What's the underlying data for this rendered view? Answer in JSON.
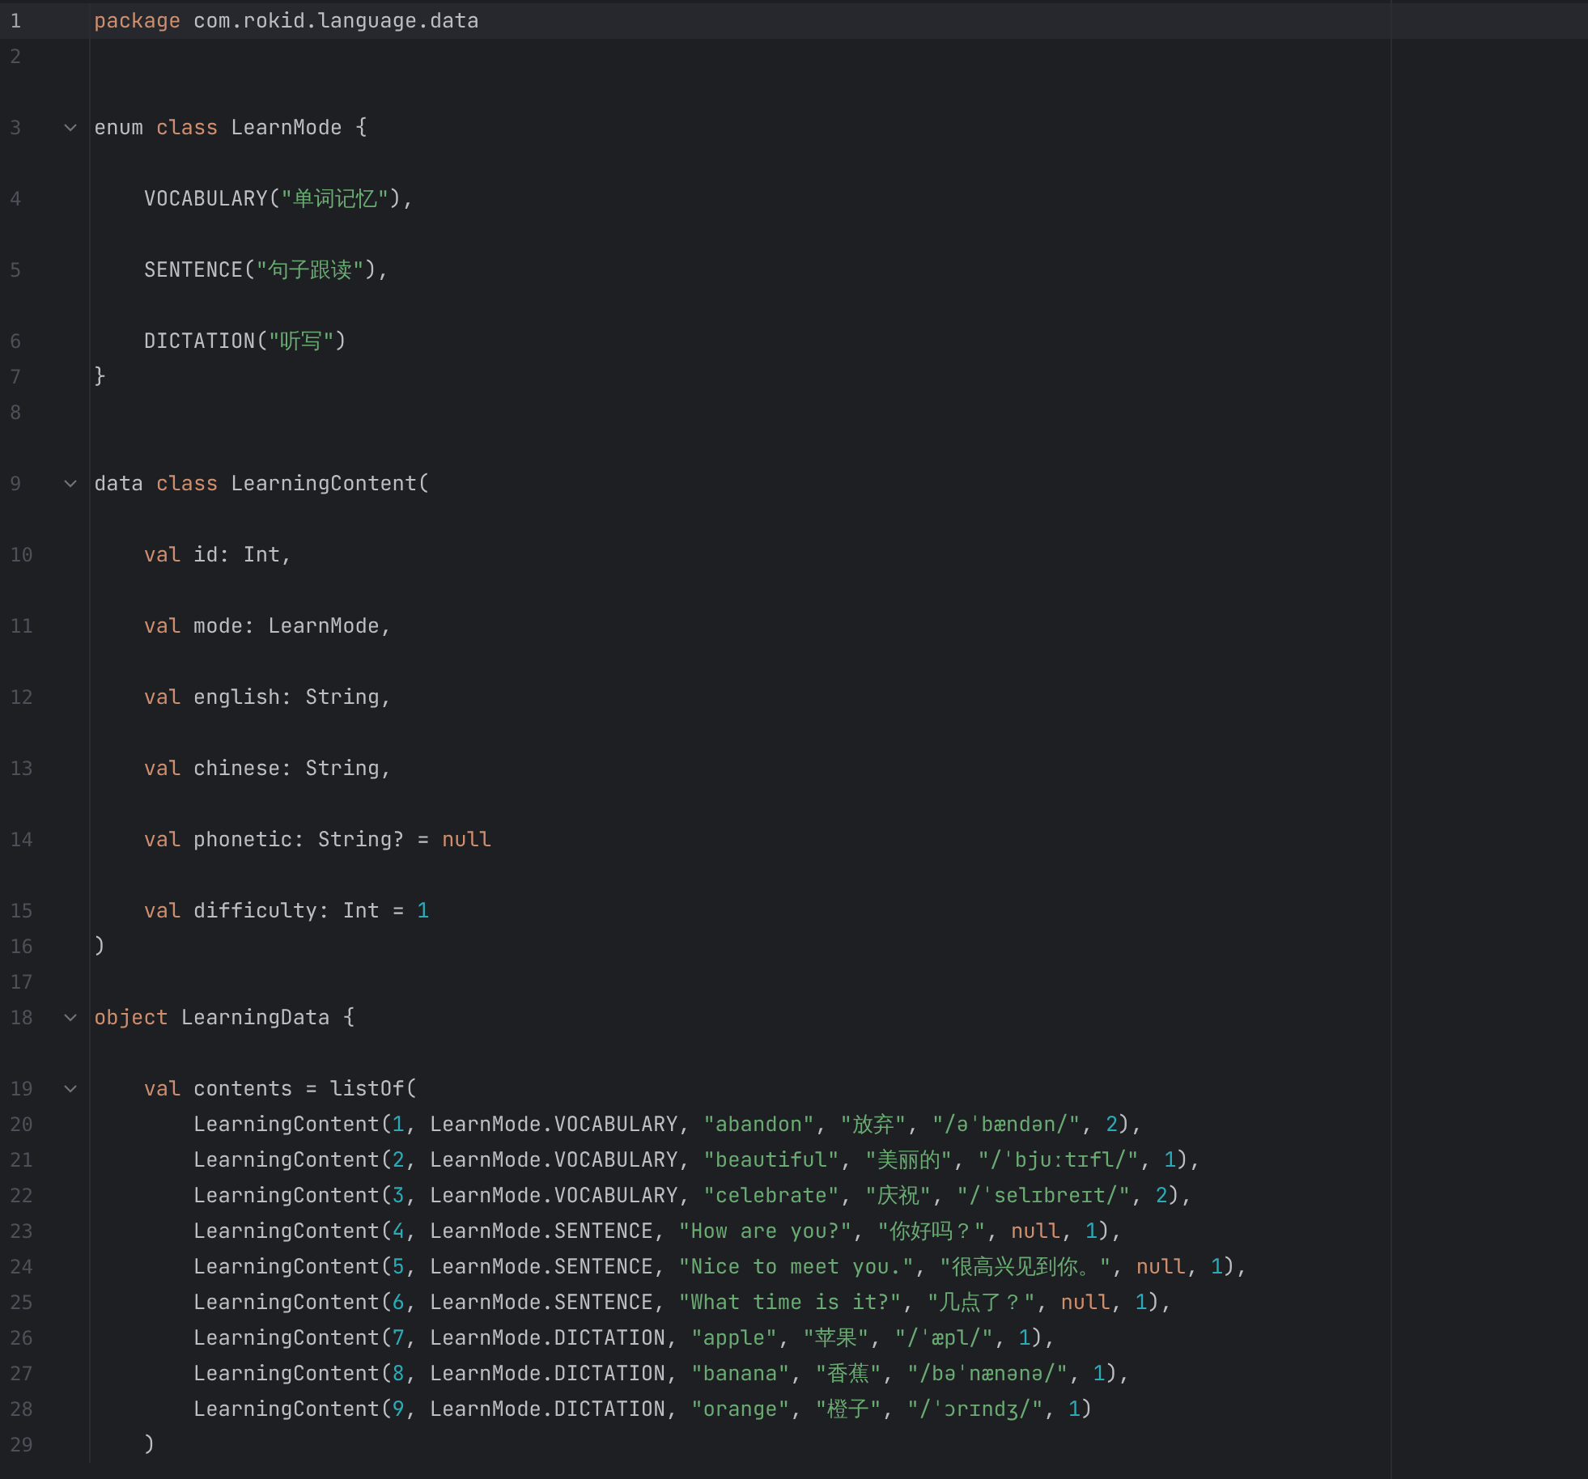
{
  "editor": {
    "lines": [
      {
        "number": "1",
        "current": true,
        "tokens": [
          {
            "kind": "kw",
            "text": "package"
          },
          {
            "kind": "plain",
            "text": " com.rokid.language.data"
          }
        ]
      },
      {
        "number": "2",
        "current": false
      },
      {
        "number": "3",
        "current": false,
        "hint_gap": true,
        "foldable": true,
        "tokens": [
          {
            "kind": "plain",
            "text": "enum "
          },
          {
            "kind": "kw",
            "text": "class"
          },
          {
            "kind": "plain",
            "text": " LearnMode {"
          }
        ]
      },
      {
        "number": "4",
        "current": false,
        "hint_gap": true,
        "tokens": [
          {
            "kind": "plain",
            "text": "    VOCABULARY("
          },
          {
            "kind": "str",
            "text": "\"单词记忆\""
          },
          {
            "kind": "plain",
            "text": "),"
          }
        ]
      },
      {
        "number": "5",
        "current": false,
        "hint_gap": true,
        "tokens": [
          {
            "kind": "plain",
            "text": "    SENTENCE("
          },
          {
            "kind": "str",
            "text": "\"句子跟读\""
          },
          {
            "kind": "plain",
            "text": "),"
          }
        ]
      },
      {
        "number": "6",
        "current": false,
        "hint_gap": true,
        "tokens": [
          {
            "kind": "plain",
            "text": "    DICTATION("
          },
          {
            "kind": "str",
            "text": "\"听写\""
          },
          {
            "kind": "plain",
            "text": ")"
          }
        ]
      },
      {
        "number": "7",
        "current": false,
        "tokens": [
          {
            "kind": "plain",
            "text": "}"
          }
        ]
      },
      {
        "number": "8",
        "current": false
      },
      {
        "number": "9",
        "current": false,
        "hint_gap": true,
        "foldable": true,
        "tokens": [
          {
            "kind": "plain",
            "text": "data "
          },
          {
            "kind": "kw",
            "text": "class"
          },
          {
            "kind": "plain",
            "text": " LearningContent("
          }
        ]
      },
      {
        "number": "10",
        "current": false,
        "hint_gap": true,
        "tokens": [
          {
            "kind": "kw",
            "text": "    val"
          },
          {
            "kind": "plain",
            "text": " id: Int,"
          }
        ]
      },
      {
        "number": "11",
        "current": false,
        "hint_gap": true,
        "tokens": [
          {
            "kind": "kw",
            "text": "    val"
          },
          {
            "kind": "plain",
            "text": " mode: LearnMode,"
          }
        ]
      },
      {
        "number": "12",
        "current": false,
        "hint_gap": true,
        "tokens": [
          {
            "kind": "kw",
            "text": "    val"
          },
          {
            "kind": "plain",
            "text": " english: String,"
          }
        ]
      },
      {
        "number": "13",
        "current": false,
        "hint_gap": true,
        "tokens": [
          {
            "kind": "kw",
            "text": "    val"
          },
          {
            "kind": "plain",
            "text": " chinese: String,"
          }
        ]
      },
      {
        "number": "14",
        "current": false,
        "hint_gap": true,
        "tokens": [
          {
            "kind": "kw",
            "text": "    val"
          },
          {
            "kind": "plain",
            "text": " phonetic: String? = "
          },
          {
            "kind": "kw",
            "text": "null"
          }
        ]
      },
      {
        "number": "15",
        "current": false,
        "hint_gap": true,
        "tokens": [
          {
            "kind": "kw",
            "text": "    val"
          },
          {
            "kind": "plain",
            "text": " difficulty: Int = "
          },
          {
            "kind": "num",
            "text": "1"
          }
        ]
      },
      {
        "number": "16",
        "current": false,
        "tokens": [
          {
            "kind": "plain",
            "text": ")"
          }
        ]
      },
      {
        "number": "17",
        "current": false
      },
      {
        "number": "18",
        "current": false,
        "foldable": true,
        "tokens": [
          {
            "kind": "kw",
            "text": "object"
          },
          {
            "kind": "plain",
            "text": " LearningData {"
          }
        ]
      },
      {
        "number": "19",
        "current": false,
        "hint_gap": true,
        "foldable": true,
        "tokens": [
          {
            "kind": "kw",
            "text": "    val"
          },
          {
            "kind": "plain",
            "text": " contents = listOf("
          }
        ]
      },
      {
        "number": "20",
        "current": false,
        "tokens": [
          {
            "kind": "plain",
            "text": "        LearningContent("
          },
          {
            "kind": "num",
            "text": "1"
          },
          {
            "kind": "plain",
            "text": ", LearnMode.VOCABULARY, "
          },
          {
            "kind": "str",
            "text": "\"abandon\""
          },
          {
            "kind": "plain",
            "text": ", "
          },
          {
            "kind": "str",
            "text": "\"放弃\""
          },
          {
            "kind": "plain",
            "text": ", "
          },
          {
            "kind": "str",
            "text": "\"/əˈbændən/\""
          },
          {
            "kind": "plain",
            "text": ", "
          },
          {
            "kind": "num",
            "text": "2"
          },
          {
            "kind": "plain",
            "text": "),"
          }
        ]
      },
      {
        "number": "21",
        "current": false,
        "tokens": [
          {
            "kind": "plain",
            "text": "        LearningContent("
          },
          {
            "kind": "num",
            "text": "2"
          },
          {
            "kind": "plain",
            "text": ", LearnMode.VOCABULARY, "
          },
          {
            "kind": "str",
            "text": "\"beautiful\""
          },
          {
            "kind": "plain",
            "text": ", "
          },
          {
            "kind": "str",
            "text": "\"美丽的\""
          },
          {
            "kind": "plain",
            "text": ", "
          },
          {
            "kind": "str",
            "text": "\"/ˈbjuːtɪfl/\""
          },
          {
            "kind": "plain",
            "text": ", "
          },
          {
            "kind": "num",
            "text": "1"
          },
          {
            "kind": "plain",
            "text": "),"
          }
        ]
      },
      {
        "number": "22",
        "current": false,
        "tokens": [
          {
            "kind": "plain",
            "text": "        LearningContent("
          },
          {
            "kind": "num",
            "text": "3"
          },
          {
            "kind": "plain",
            "text": ", LearnMode.VOCABULARY, "
          },
          {
            "kind": "str",
            "text": "\"celebrate\""
          },
          {
            "kind": "plain",
            "text": ", "
          },
          {
            "kind": "str",
            "text": "\"庆祝\""
          },
          {
            "kind": "plain",
            "text": ", "
          },
          {
            "kind": "str",
            "text": "\"/ˈselɪbreɪt/\""
          },
          {
            "kind": "plain",
            "text": ", "
          },
          {
            "kind": "num",
            "text": "2"
          },
          {
            "kind": "plain",
            "text": "),"
          }
        ]
      },
      {
        "number": "23",
        "current": false,
        "tokens": [
          {
            "kind": "plain",
            "text": "        LearningContent("
          },
          {
            "kind": "num",
            "text": "4"
          },
          {
            "kind": "plain",
            "text": ", LearnMode.SENTENCE, "
          },
          {
            "kind": "str",
            "text": "\"How are you?\""
          },
          {
            "kind": "plain",
            "text": ", "
          },
          {
            "kind": "str",
            "text": "\"你好吗？\""
          },
          {
            "kind": "plain",
            "text": ", "
          },
          {
            "kind": "kw",
            "text": "null"
          },
          {
            "kind": "plain",
            "text": ", "
          },
          {
            "kind": "num",
            "text": "1"
          },
          {
            "kind": "plain",
            "text": "),"
          }
        ]
      },
      {
        "number": "24",
        "current": false,
        "tokens": [
          {
            "kind": "plain",
            "text": "        LearningContent("
          },
          {
            "kind": "num",
            "text": "5"
          },
          {
            "kind": "plain",
            "text": ", LearnMode.SENTENCE, "
          },
          {
            "kind": "str",
            "text": "\"Nice to meet you.\""
          },
          {
            "kind": "plain",
            "text": ", "
          },
          {
            "kind": "str",
            "text": "\"很高兴见到你。\""
          },
          {
            "kind": "plain",
            "text": ", "
          },
          {
            "kind": "kw",
            "text": "null"
          },
          {
            "kind": "plain",
            "text": ", "
          },
          {
            "kind": "num",
            "text": "1"
          },
          {
            "kind": "plain",
            "text": "),"
          }
        ]
      },
      {
        "number": "25",
        "current": false,
        "tokens": [
          {
            "kind": "plain",
            "text": "        LearningContent("
          },
          {
            "kind": "num",
            "text": "6"
          },
          {
            "kind": "plain",
            "text": ", LearnMode.SENTENCE, "
          },
          {
            "kind": "str",
            "text": "\"What time is it?\""
          },
          {
            "kind": "plain",
            "text": ", "
          },
          {
            "kind": "str",
            "text": "\"几点了？\""
          },
          {
            "kind": "plain",
            "text": ", "
          },
          {
            "kind": "kw",
            "text": "null"
          },
          {
            "kind": "plain",
            "text": ", "
          },
          {
            "kind": "num",
            "text": "1"
          },
          {
            "kind": "plain",
            "text": "),"
          }
        ]
      },
      {
        "number": "26",
        "current": false,
        "tokens": [
          {
            "kind": "plain",
            "text": "        LearningContent("
          },
          {
            "kind": "num",
            "text": "7"
          },
          {
            "kind": "plain",
            "text": ", LearnMode.DICTATION, "
          },
          {
            "kind": "str",
            "text": "\"apple\""
          },
          {
            "kind": "plain",
            "text": ", "
          },
          {
            "kind": "str",
            "text": "\"苹果\""
          },
          {
            "kind": "plain",
            "text": ", "
          },
          {
            "kind": "str",
            "text": "\"/ˈæpl/\""
          },
          {
            "kind": "plain",
            "text": ", "
          },
          {
            "kind": "num",
            "text": "1"
          },
          {
            "kind": "plain",
            "text": "),"
          }
        ]
      },
      {
        "number": "27",
        "current": false,
        "tokens": [
          {
            "kind": "plain",
            "text": "        LearningContent("
          },
          {
            "kind": "num",
            "text": "8"
          },
          {
            "kind": "plain",
            "text": ", LearnMode.DICTATION, "
          },
          {
            "kind": "str",
            "text": "\"banana\""
          },
          {
            "kind": "plain",
            "text": ", "
          },
          {
            "kind": "str",
            "text": "\"香蕉\""
          },
          {
            "kind": "plain",
            "text": ", "
          },
          {
            "kind": "str",
            "text": "\"/bəˈnænənə/\""
          },
          {
            "kind": "plain",
            "text": ", "
          },
          {
            "kind": "num",
            "text": "1"
          },
          {
            "kind": "plain",
            "text": "),"
          }
        ]
      },
      {
        "number": "28",
        "current": false,
        "tokens": [
          {
            "kind": "plain",
            "text": "        LearningContent("
          },
          {
            "kind": "num",
            "text": "9"
          },
          {
            "kind": "plain",
            "text": ", LearnMode.DICTATION, "
          },
          {
            "kind": "str",
            "text": "\"orange\""
          },
          {
            "kind": "plain",
            "text": ", "
          },
          {
            "kind": "str",
            "text": "\"橙子\""
          },
          {
            "kind": "plain",
            "text": ", "
          },
          {
            "kind": "str",
            "text": "\"/ˈɔrɪndʒ/\""
          },
          {
            "kind": "plain",
            "text": ", "
          },
          {
            "kind": "num",
            "text": "1"
          },
          {
            "kind": "plain",
            "text": ")"
          }
        ]
      },
      {
        "number": "29",
        "current": false,
        "tokens": [
          {
            "kind": "plain",
            "text": "    )"
          }
        ]
      }
    ]
  }
}
